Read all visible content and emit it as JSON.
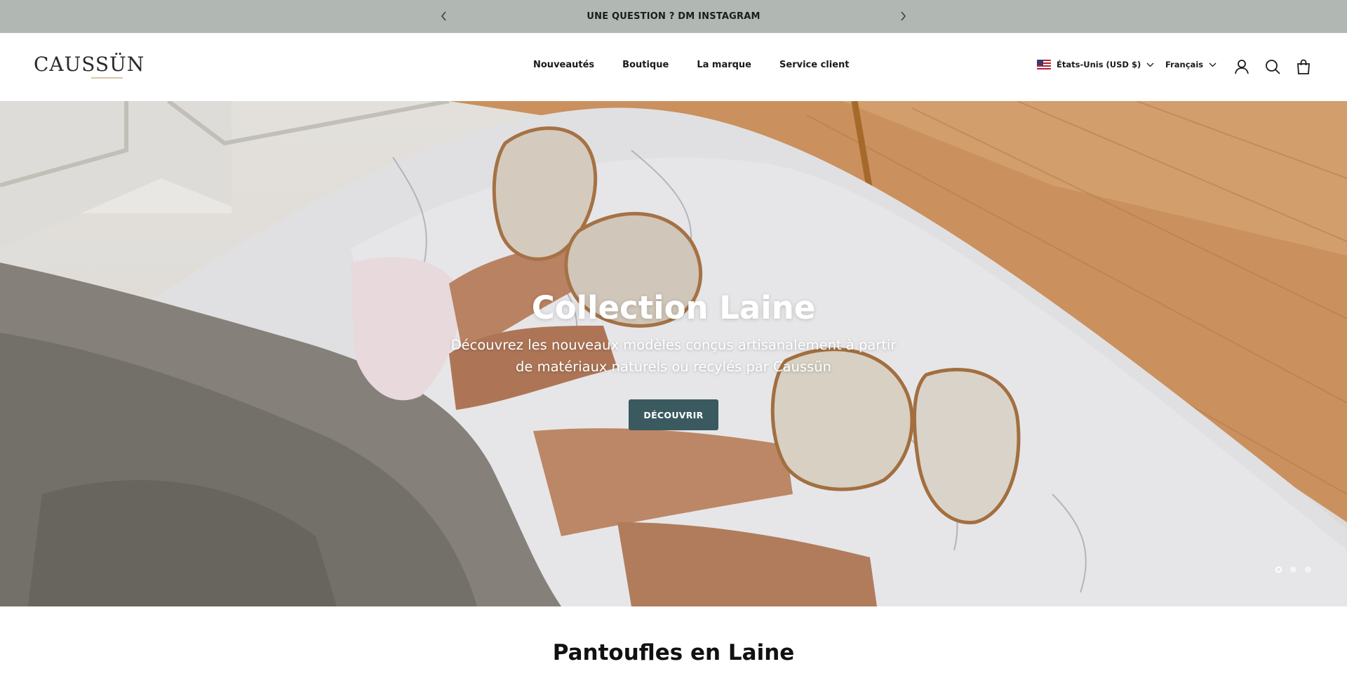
{
  "announcement": {
    "text": "UNE QUESTION ? DM INSTAGRAM"
  },
  "header": {
    "logo_text": "CAUSSÜN",
    "nav": [
      "Nouveautés",
      "Boutique",
      "La marque",
      "Service client"
    ],
    "country_label": "États-Unis (USD $)",
    "language_label": "Français",
    "icons": [
      "account-icon",
      "search-icon",
      "cart-icon"
    ]
  },
  "hero": {
    "title": "Collection Laine",
    "subtitle": "Découvrez les nouveaux modèles conçus artisanalement à partir de matériaux naturels ou recylés par Caussün",
    "button_label": "DÉCOUVRIR",
    "slides_count": 3,
    "active_slide": 1
  },
  "section": {
    "title": "Pantoufles en Laine"
  },
  "colors": {
    "announcement_bg": "#b1b8b4",
    "button_bg": "#3a5a5f",
    "text": "#1a1a1a"
  }
}
